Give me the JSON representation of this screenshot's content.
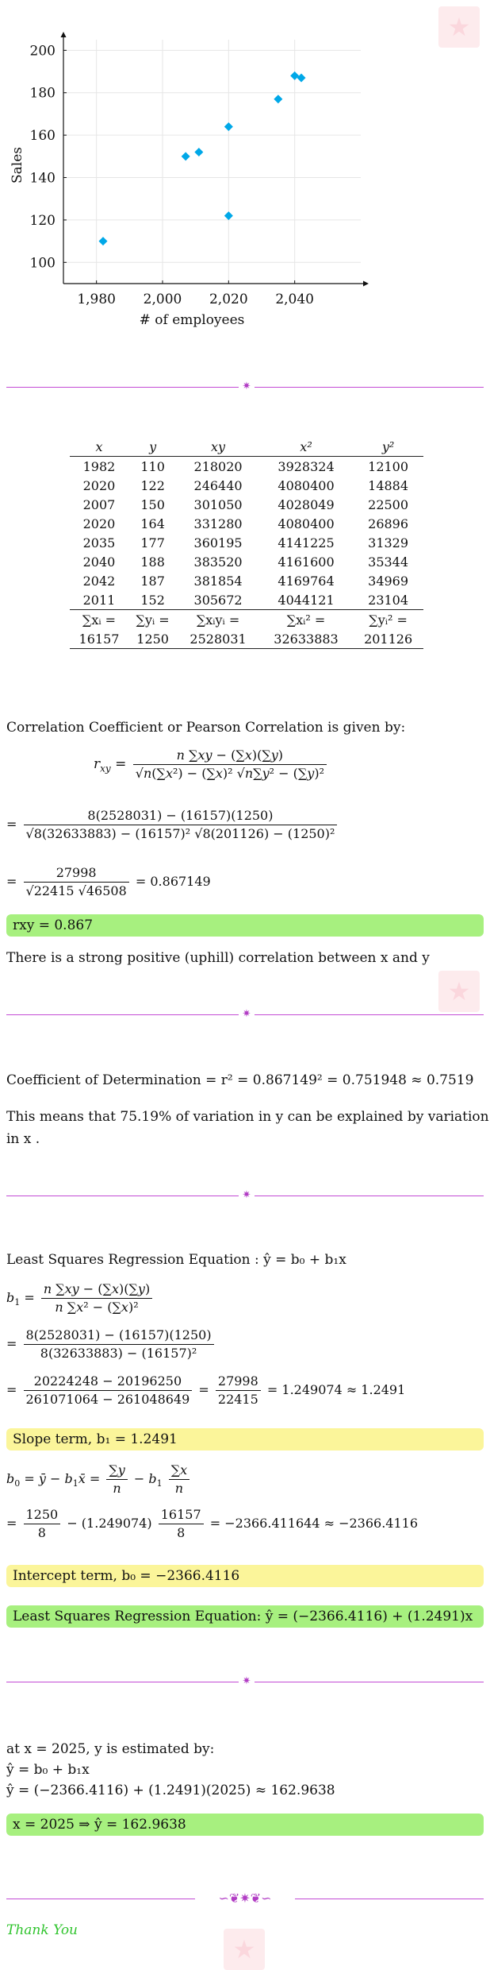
{
  "chart_data": {
    "type": "scatter",
    "x": [
      1982,
      2020,
      2007,
      2020,
      2035,
      2040,
      2042,
      2011
    ],
    "y": [
      110,
      122,
      150,
      164,
      177,
      188,
      187,
      152
    ],
    "xlabel": "# of employees",
    "ylabel": "Sales",
    "xlim": [
      1970,
      2060
    ],
    "ylim": [
      90,
      205
    ],
    "xticks": [
      "1,980",
      "2,000",
      "2,020",
      "2,040"
    ],
    "yticks": [
      "100",
      "120",
      "140",
      "160",
      "180",
      "200"
    ],
    "xtick_values": [
      1980,
      2000,
      2020,
      2040
    ],
    "ytick_values": [
      100,
      120,
      140,
      160,
      180,
      200
    ],
    "marker_color": "#00a8e8",
    "grid": true
  },
  "table": {
    "headers": [
      "x",
      "y",
      "xy",
      "x²",
      "y²"
    ],
    "rows": [
      [
        "1982",
        "110",
        "218020",
        "3928324",
        "12100"
      ],
      [
        "2020",
        "122",
        "246440",
        "4080400",
        "14884"
      ],
      [
        "2007",
        "150",
        "301050",
        "4028049",
        "22500"
      ],
      [
        "2020",
        "164",
        "331280",
        "4080400",
        "26896"
      ],
      [
        "2035",
        "177",
        "360195",
        "4141225",
        "31329"
      ],
      [
        "2040",
        "188",
        "383520",
        "4161600",
        "35344"
      ],
      [
        "2042",
        "187",
        "381854",
        "4169764",
        "34969"
      ],
      [
        "2011",
        "152",
        "305672",
        "4044121",
        "23104"
      ]
    ],
    "sum_labels": [
      "∑xᵢ =",
      "∑yᵢ =",
      "∑xᵢyᵢ =",
      "∑xᵢ² =",
      "∑yᵢ² ="
    ],
    "sum_values": [
      "16157",
      "1250",
      "2528031",
      "32633883",
      "201126"
    ]
  },
  "correlation": {
    "intro": "Correlation Coefficient or Pearson Correlation is given by:",
    "step1_num": "8(2528031) − (16157)(1250)",
    "step1_den": "√8(32633883) − (16157)² √8(201126) − (1250)²",
    "step2_num": "27998",
    "step2_den": "√22415 √46508",
    "step2_result": "= 0.867149",
    "result": "rxy = 0.867",
    "interpretation": "There is a strong positive (uphill) correlation between x and y"
  },
  "determination": {
    "line": "Coefficient of Determination = r² = 0.867149² = 0.751948 ≈ 0.7519",
    "explain1": "This means that 75.19% of variation in y can be explained by variation",
    "explain2": "in x ."
  },
  "regression": {
    "title": "Least Squares Regression Equation : ŷ = b₀ + b₁x",
    "b1_step1_num": "8(2528031) − (16157)(1250)",
    "b1_step1_den": "8(32633883) − (16157)²",
    "b1_step2_num1": "20224248 − 20196250",
    "b1_step2_den1": "261071064 − 261048649",
    "b1_step2_num2": "27998",
    "b1_step2_den2": "22415",
    "b1_step2_result": "= 1.249074 ≈ 1.2491",
    "slope": "Slope term, b₁ = 1.2491",
    "b0_step_num1": "1250",
    "b0_step_den1": "8",
    "b0_step_mid": "− (1.249074)",
    "b0_step_num2": "16157",
    "b0_step_den2": "8",
    "b0_step_result": "= −2366.411644 ≈ −2366.4116",
    "intercept": "Intercept term, b₀ = −2366.4116",
    "equation": "Least Squares Regression Equation:  ŷ = (−2366.4116) + (1.2491)x"
  },
  "estimate": {
    "line1": "at x = 2025, y is estimated by:",
    "line2": "ŷ = b₀ + b₁x",
    "line3": "ŷ = (−2366.4116) + (1.2491)(2025) ≈ 162.9638",
    "result": "x = 2025 ⇒ ŷ = 162.9638"
  },
  "closing": "Thank You"
}
